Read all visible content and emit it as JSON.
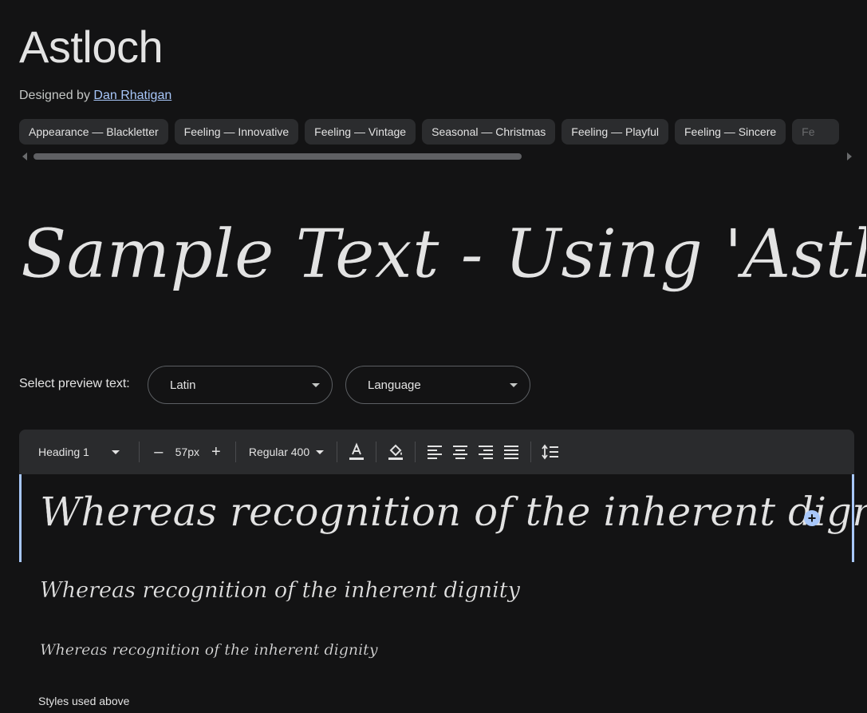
{
  "font": {
    "name": "Astloch",
    "designed_by_label": "Designed by",
    "designer": "Dan Rhatigan"
  },
  "tags": [
    "Appearance — Blackletter",
    "Feeling — Innovative",
    "Feeling — Vintage",
    "Seasonal — Christmas",
    "Feeling — Playful",
    "Feeling — Sincere",
    "Fe"
  ],
  "hero_sample": "Sample Text - Using 'Astloch' Font.",
  "preview": {
    "label": "Select preview text:",
    "script_value": "Latin",
    "language_value": "Language"
  },
  "toolbar": {
    "style_value": "Heading 1",
    "decrease": "–",
    "size_value": "57px",
    "increase": "+",
    "weight_value": "Regular 400"
  },
  "specimens": [
    "Whereas recognition of the inherent dignity",
    "Whereas recognition of the inherent dignity",
    "Whereas recognition of the inherent dignity"
  ],
  "add_button": "+",
  "styles_used_label": "Styles used above",
  "colors": {
    "background": "#131314",
    "chip": "#2b2c2e",
    "accent": "#a8c7fa",
    "toolbar": "#2a2b2d"
  }
}
